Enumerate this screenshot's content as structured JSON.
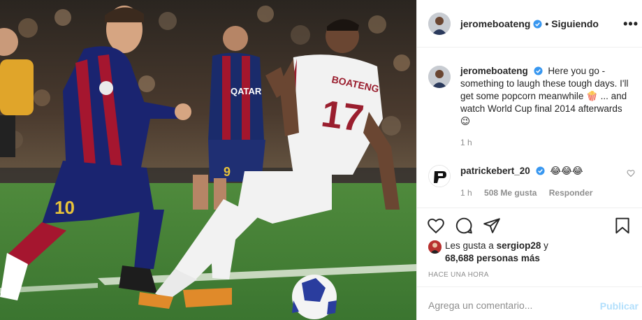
{
  "post": {
    "photo_alt_subject": "football-match-photo",
    "jersey_back_name": "BOATENG",
    "jersey_back_number": "17",
    "jersey_front_number": "10",
    "jersey_number_background_player": "9",
    "sponsor_text": "QATAR"
  },
  "header": {
    "username": "jeromeboateng",
    "separator": "•",
    "follow_state": "Siguiendo",
    "more_label": "•••"
  },
  "caption": {
    "username": "jeromeboateng",
    "text": "Here you go - something to laugh these tough days. I'll get some popcorn meanwhile 🍿 ... and watch World Cup final 2014 afterwards 😉",
    "time": "1 h"
  },
  "comment": {
    "username": "patrickebert_20",
    "text": "😂😂😂",
    "time": "1 h",
    "likes": "508 Me gusta",
    "reply": "Responder"
  },
  "likes": {
    "prefix": "Les gusta a",
    "user": "sergiop28",
    "conj": "y",
    "count": "68,688 personas más"
  },
  "posted_ago": "HACE UNA HORA",
  "add_comment": {
    "placeholder": "Agrega un comentario...",
    "publish_label": "Publicar"
  },
  "colors": {
    "verified": "#3897f0",
    "publish_disabled": "#b2dffc",
    "muted": "#8e8e8e",
    "border": "#efefef"
  }
}
